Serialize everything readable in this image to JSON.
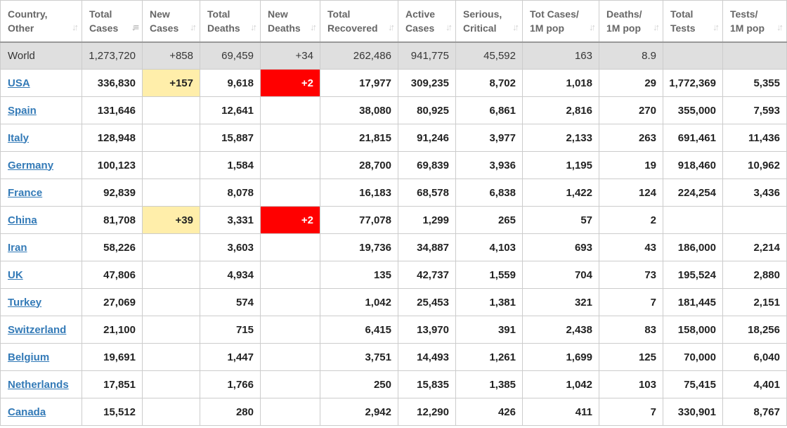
{
  "colors": {
    "link": "#337ab7",
    "new_cases_highlight": "#ffeeaa",
    "new_deaths_highlight": "#ff0000",
    "world_row_bg": "#dfdfdf"
  },
  "headers": [
    {
      "line1": "Country,",
      "line2": "Other",
      "sort_icon": "sort-both-icon"
    },
    {
      "line1": "Total",
      "line2": "Cases",
      "sort_icon": "sort-desc-active-icon"
    },
    {
      "line1": "New",
      "line2": "Cases",
      "sort_icon": "sort-both-icon"
    },
    {
      "line1": "Total",
      "line2": "Deaths",
      "sort_icon": "sort-both-icon"
    },
    {
      "line1": "New",
      "line2": "Deaths",
      "sort_icon": "sort-both-icon"
    },
    {
      "line1": "Total",
      "line2": "Recovered",
      "sort_icon": "sort-both-icon"
    },
    {
      "line1": "Active",
      "line2": "Cases",
      "sort_icon": "sort-both-icon"
    },
    {
      "line1": "Serious,",
      "line2": "Critical",
      "sort_icon": "sort-both-icon"
    },
    {
      "line1": "Tot Cases/",
      "line2": "1M pop",
      "sort_icon": "sort-both-icon"
    },
    {
      "line1": "Deaths/",
      "line2": "1M pop",
      "sort_icon": "sort-both-icon"
    },
    {
      "line1": "Total",
      "line2": "Tests",
      "sort_icon": "sort-both-icon"
    },
    {
      "line1": "Tests/",
      "line2": "1M pop",
      "sort_icon": "sort-both-icon"
    }
  ],
  "sort_glyphs": {
    "both": "↓↑",
    "desc_active": "↓≡"
  },
  "world": [
    "World",
    "1,273,720",
    "+858",
    "69,459",
    "+34",
    "262,486",
    "941,775",
    "45,592",
    "163",
    "8.9",
    "",
    ""
  ],
  "rows": [
    [
      "USA",
      "336,830",
      "+157",
      "9,618",
      "+2",
      "17,977",
      "309,235",
      "8,702",
      "1,018",
      "29",
      "1,772,369",
      "5,355"
    ],
    [
      "Spain",
      "131,646",
      "",
      "12,641",
      "",
      "38,080",
      "80,925",
      "6,861",
      "2,816",
      "270",
      "355,000",
      "7,593"
    ],
    [
      "Italy",
      "128,948",
      "",
      "15,887",
      "",
      "21,815",
      "91,246",
      "3,977",
      "2,133",
      "263",
      "691,461",
      "11,436"
    ],
    [
      "Germany",
      "100,123",
      "",
      "1,584",
      "",
      "28,700",
      "69,839",
      "3,936",
      "1,195",
      "19",
      "918,460",
      "10,962"
    ],
    [
      "France",
      "92,839",
      "",
      "8,078",
      "",
      "16,183",
      "68,578",
      "6,838",
      "1,422",
      "124",
      "224,254",
      "3,436"
    ],
    [
      "China",
      "81,708",
      "+39",
      "3,331",
      "+2",
      "77,078",
      "1,299",
      "265",
      "57",
      "2",
      "",
      ""
    ],
    [
      "Iran",
      "58,226",
      "",
      "3,603",
      "",
      "19,736",
      "34,887",
      "4,103",
      "693",
      "43",
      "186,000",
      "2,214"
    ],
    [
      "UK",
      "47,806",
      "",
      "4,934",
      "",
      "135",
      "42,737",
      "1,559",
      "704",
      "73",
      "195,524",
      "2,880"
    ],
    [
      "Turkey",
      "27,069",
      "",
      "574",
      "",
      "1,042",
      "25,453",
      "1,381",
      "321",
      "7",
      "181,445",
      "2,151"
    ],
    [
      "Switzerland",
      "21,100",
      "",
      "715",
      "",
      "6,415",
      "13,970",
      "391",
      "2,438",
      "83",
      "158,000",
      "18,256"
    ],
    [
      "Belgium",
      "19,691",
      "",
      "1,447",
      "",
      "3,751",
      "14,493",
      "1,261",
      "1,699",
      "125",
      "70,000",
      "6,040"
    ],
    [
      "Netherlands",
      "17,851",
      "",
      "1,766",
      "",
      "250",
      "15,835",
      "1,385",
      "1,042",
      "103",
      "75,415",
      "4,401"
    ],
    [
      "Canada",
      "15,512",
      "",
      "280",
      "",
      "2,942",
      "12,290",
      "426",
      "411",
      "7",
      "330,901",
      "8,767"
    ]
  ]
}
